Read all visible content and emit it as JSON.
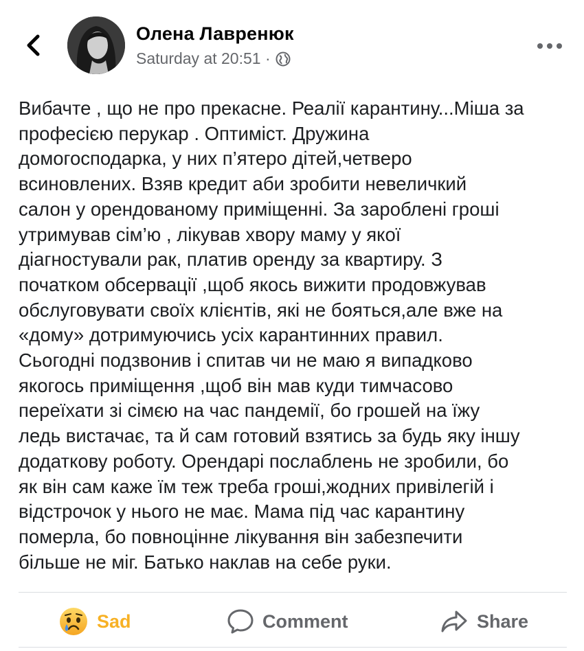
{
  "post": {
    "author": "Олена Лавренюк",
    "timestamp": "Saturday at 20:51 ·",
    "audience_icon": "globe-icon",
    "text": "Вибачте , що не про прекасне. Реалії карантину...Міша за\nпрофесією перукар . Оптиміст. Дружина\nдомогосподарка, у них п’ятеро дітей,четверо\nвсиновлених. Взяв кредит аби зробити невеличкий\nсалон у орендованому приміщенні. За зароблені гроші\nутримував сім’ю , лікував хвору маму у якої\nдіагностували рак, платив оренду за квартиру. З\nпочатком обсервації ,щоб якось вижити продовжував\nобслуговувати своїх клієнтів, які не бояться,але вже на\n«дому» дотримуючись усіх карантинних правил.\nСьогодні  подзвонив і спитав чи не маю я випадково\nякогось приміщення ,щоб він мав куди тимчасово\nпереїхати зі сімєю на час пандемії, бо грошей на їжу\nледь вистачає, та й сам готовий взятись за будь яку іншу\nдодаткову роботу. Орендарі послаблень не зробили, бо\nяк він сам каже їм теж треба гроші,жодних привілегій і\nвідстрочок у нього не має. Мама під час карантину\nпомерла, бо повноцінне лікування він забезпечити\nбільше не міг. Батько наклав на себе руки."
  },
  "actions": {
    "sad_label": "Sad",
    "comment_label": "Comment",
    "share_label": "Share"
  },
  "colors": {
    "sad_accent": "#f7b125",
    "muted": "#65676b",
    "text": "#1c1e21",
    "divider": "#dadde1"
  }
}
